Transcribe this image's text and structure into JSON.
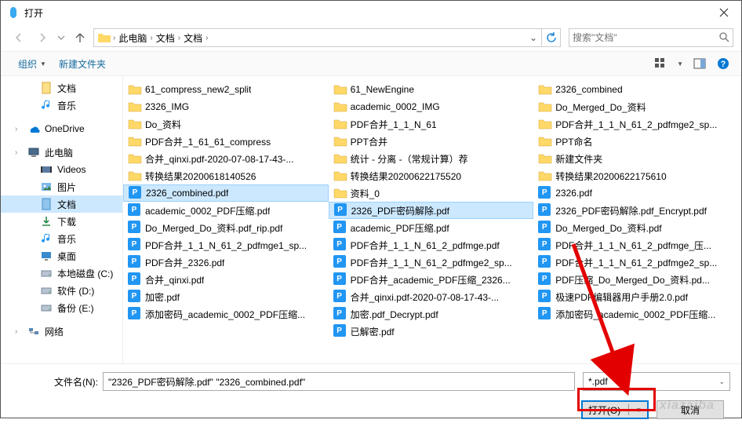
{
  "title": "打开",
  "breadcrumb": {
    "segments": [
      "此电脑",
      "文档",
      "文档"
    ],
    "search_placeholder": "搜索\"文档\""
  },
  "toolbar": {
    "organize": "组织",
    "new_folder": "新建文件夹"
  },
  "tree": [
    {
      "label": "文档",
      "icon": "doc",
      "level": 1,
      "type": "yellow-doc"
    },
    {
      "label": "音乐",
      "icon": "music",
      "level": 1,
      "type": "music"
    },
    {
      "label": "OneDrive",
      "icon": "onedrive",
      "level": 0,
      "type": "onedrive",
      "gap": true
    },
    {
      "label": "此电脑",
      "icon": "pc",
      "level": 0,
      "type": "pc",
      "gap": true
    },
    {
      "label": "Videos",
      "icon": "video",
      "level": 1,
      "type": "video"
    },
    {
      "label": "图片",
      "icon": "pic",
      "level": 1,
      "type": "pic"
    },
    {
      "label": "文档",
      "icon": "doc",
      "level": 1,
      "type": "doc",
      "selected": true
    },
    {
      "label": "下载",
      "icon": "download",
      "level": 1,
      "type": "download"
    },
    {
      "label": "音乐",
      "icon": "music",
      "level": 1,
      "type": "music"
    },
    {
      "label": "桌面",
      "icon": "desktop",
      "level": 1,
      "type": "desktop"
    },
    {
      "label": "本地磁盘 (C:)",
      "icon": "drive",
      "level": 1,
      "type": "drive"
    },
    {
      "label": "软件 (D:)",
      "icon": "drive",
      "level": 1,
      "type": "drive"
    },
    {
      "label": "备份 (E:)",
      "icon": "drive",
      "level": 1,
      "type": "drive"
    },
    {
      "label": "网络",
      "icon": "network",
      "level": 0,
      "type": "network",
      "gap": true
    }
  ],
  "columns": [
    [
      {
        "name": "61_compress_new2_split",
        "type": "folder"
      },
      {
        "name": "2326_IMG",
        "type": "folder"
      },
      {
        "name": "Do_资料",
        "type": "folder"
      },
      {
        "name": "PDF合并_1_61_61_compress",
        "type": "folder"
      },
      {
        "name": "合并_qinxi.pdf-2020-07-08-17-43-...",
        "type": "folder"
      },
      {
        "name": "转换结果20200618140526",
        "type": "folder"
      },
      {
        "name": "2326_combined.pdf",
        "type": "pdf",
        "selected": true
      },
      {
        "name": "academic_0002_PDF压缩.pdf",
        "type": "pdf"
      },
      {
        "name": "Do_Merged_Do_资料.pdf_rip.pdf",
        "type": "pdf"
      },
      {
        "name": "PDF合并_1_1_N_61_2_pdfmge1_sp...",
        "type": "pdf"
      },
      {
        "name": "PDF合并_2326.pdf",
        "type": "pdf"
      },
      {
        "name": "合并_qinxi.pdf",
        "type": "pdf"
      },
      {
        "name": "加密.pdf",
        "type": "pdf"
      },
      {
        "name": "添加密码_academic_0002_PDF压缩...",
        "type": "pdf"
      }
    ],
    [
      {
        "name": "61_NewEngine",
        "type": "folder"
      },
      {
        "name": "academic_0002_IMG",
        "type": "folder"
      },
      {
        "name": "PDF合并_1_1_N_61",
        "type": "folder"
      },
      {
        "name": "PPT合并",
        "type": "folder"
      },
      {
        "name": "统计 - 分离 -（常规计算）荐",
        "type": "folder"
      },
      {
        "name": "资料_0",
        "type": "folder"
      },
      {
        "name": "2326_PDF密码解除.pdf",
        "type": "pdf",
        "selected": true
      },
      {
        "name": "academic_PDF压缩.pdf",
        "type": "pdf"
      },
      {
        "name": "PDF合并_1_1_N_61_2_pdfmge.pdf",
        "type": "pdf"
      },
      {
        "name": "PDF合并_1_1_N_61_2_pdfmge2_sp...",
        "type": "pdf"
      },
      {
        "name": "PDF合并_academic_PDF压缩_2326...",
        "type": "pdf"
      },
      {
        "name": "合并_qinxi.pdf-2020-07-08-17-43-...",
        "type": "pdf"
      },
      {
        "name": "加密.pdf_Decrypt.pdf",
        "type": "pdf"
      },
      {
        "name": "已解密.pdf",
        "type": "pdf"
      }
    ],
    [
      {
        "name": "2326_combined",
        "type": "folder"
      },
      {
        "name": "Do_Merged_Do_资料",
        "type": "folder"
      },
      {
        "name": "PDF合并_1_1_N_61_2_pdfmge2_sp...",
        "type": "folder"
      },
      {
        "name": "PPT命名",
        "type": "folder"
      },
      {
        "name": "新建文件夹",
        "type": "folder"
      },
      {
        "name": "转换结果20200622175610",
        "type": "folder"
      },
      {
        "name": "2326.pdf",
        "type": "pdf"
      },
      {
        "name": "2326_PDF密码解除.pdf_Encrypt.pdf",
        "type": "pdf"
      },
      {
        "name": "Do_Merged_Do_资料.pdf",
        "type": "pdf"
      },
      {
        "name": "PDF合并_1_1_N_61_2_pdfmge_压...",
        "type": "pdf"
      },
      {
        "name": "PDF合并_1_1_N_61_2_pdfmge2_sp...",
        "type": "pdf"
      },
      {
        "name": "PDF压缩_Do_Merged_Do_资料.pd...",
        "type": "pdf"
      },
      {
        "name": "极速PDF编辑器用户手册2.0.pdf",
        "type": "pdf"
      },
      {
        "name": "添加密码_academic_0002_PDF压缩...",
        "type": "pdf"
      }
    ]
  ],
  "col2_extra": {
    "name": "转换结果20200622175520",
    "type": "folder"
  },
  "filename": {
    "label": "文件名(N):",
    "value": "\"2326_PDF密码解除.pdf\" \"2326_combined.pdf\"",
    "filter": "*.pdf"
  },
  "buttons": {
    "open": "打开(O)",
    "cancel": "取消"
  },
  "watermark": "xiazaiba"
}
